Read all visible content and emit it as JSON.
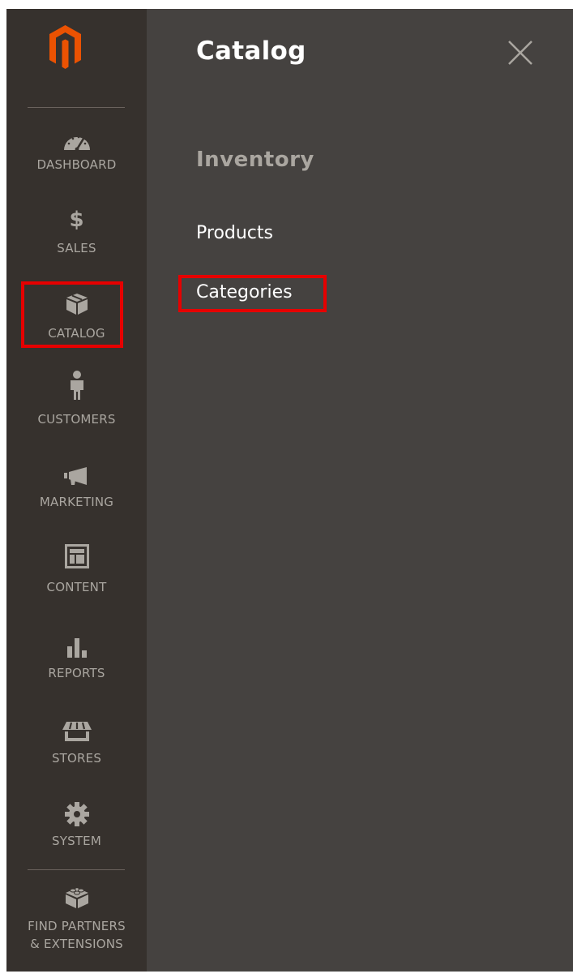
{
  "sidebar": {
    "items": [
      {
        "label": "DASHBOARD",
        "icon": "dashboard-gauge-icon"
      },
      {
        "label": "SALES",
        "icon": "dollar-icon"
      },
      {
        "label": "CATALOG",
        "icon": "box-icon"
      },
      {
        "label": "CUSTOMERS",
        "icon": "person-icon"
      },
      {
        "label": "MARKETING",
        "icon": "megaphone-icon"
      },
      {
        "label": "CONTENT",
        "icon": "layout-icon"
      },
      {
        "label": "REPORTS",
        "icon": "bar-chart-icon"
      },
      {
        "label": "STORES",
        "icon": "storefront-icon"
      },
      {
        "label": "SYSTEM",
        "icon": "gear-icon"
      },
      {
        "label_line1": "FIND PARTNERS",
        "label_line2": "& EXTENSIONS",
        "icon": "blocks-icon"
      }
    ]
  },
  "panel": {
    "title": "Catalog",
    "section_heading": "Inventory",
    "links": [
      "Products",
      "Categories"
    ]
  },
  "colors": {
    "sidebar_bg": "#36312d",
    "panel_bg": "#454240",
    "logo": "#eb5202",
    "highlight": "#e60000"
  }
}
